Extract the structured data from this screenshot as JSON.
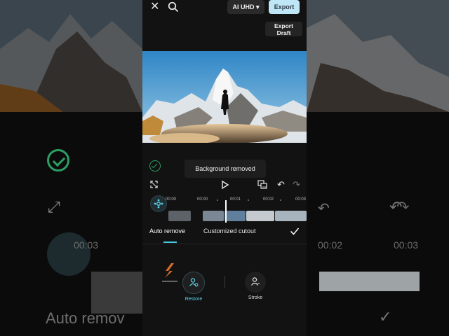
{
  "topbar": {
    "close_icon": "close-icon",
    "search_icon": "search-icon",
    "quality_label": "AI UHD",
    "export_label": "Export",
    "export_draft_line1": "Export",
    "export_draft_line2": "Draft"
  },
  "toast": {
    "message": "Background removed"
  },
  "timeline": {
    "ruler_labels": [
      "00:00",
      "00:00",
      "00:01",
      "00:02",
      "00:03"
    ]
  },
  "background": {
    "left_time": "00:03",
    "right_time1": "00:02",
    "right_time2": "00:03",
    "left_label": "Auto remov"
  },
  "tabs": [
    {
      "label": "Auto remove",
      "active": true
    },
    {
      "label": "Customized cutout",
      "active": false
    }
  ],
  "tools": [
    {
      "label": "Restore",
      "active": true
    },
    {
      "label": "Stroke",
      "active": false
    }
  ],
  "colors": {
    "accent": "#46c7e3",
    "success": "#2c9e63",
    "export_bg": "#bfe6f6"
  }
}
